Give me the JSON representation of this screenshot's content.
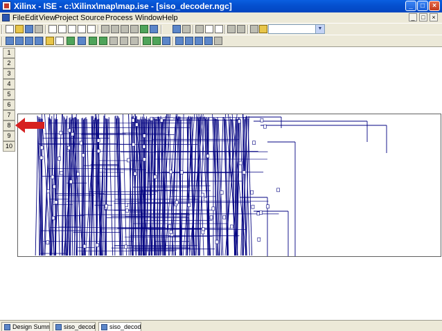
{
  "window": {
    "title": "Xilinx - ISE - c:\\Xilinx\\map\\map.ise - [siso_decoder.ngc]",
    "controls": [
      "_",
      "□",
      "×"
    ],
    "mdi_controls": [
      "_",
      "□",
      "×"
    ]
  },
  "menu": [
    "File",
    "Edit",
    "View",
    "Project",
    "Source",
    "Process",
    "Window",
    "Help"
  ],
  "search_combo": {
    "value": ""
  },
  "row_numbers": [
    "1",
    "2",
    "3",
    "4",
    "5",
    "6",
    "7",
    "8",
    "9",
    "10"
  ],
  "tabs": [
    {
      "label": "Design Summary",
      "active": false
    },
    {
      "label": "siso_decoder",
      "active": false
    },
    {
      "label": "siso_decoder",
      "active": true
    }
  ],
  "colors": {
    "wire": "#000080",
    "annotation_arrow": "#D62020",
    "titlebar": "#0A5FE0"
  },
  "icons": {
    "toolbar1": [
      "new-file-icon",
      "open-folder-icon",
      "save-icon",
      "print-icon",
      "print-preview-icon",
      "document-icon",
      "document-icon",
      "document-icon",
      "document-icon",
      "document-icon",
      "gear-icon",
      "wrench-icon",
      "wrench-icon",
      "wrench-icon",
      "wrench-icon",
      "chart-icon",
      "tool-icon",
      "question-cursor-icon",
      "cut-icon",
      "copy-icon",
      "paste-icon",
      "undo-icon",
      "redo-icon",
      "binoculars-icon",
      "find-icon"
    ],
    "toolbar2": [
      "cascade-icon",
      "tile-icon",
      "layout-icon",
      "layout-icon",
      "lightbulb-icon",
      "pointer-icon",
      "schematic-icon",
      "grid-icon",
      "tree-icon",
      "tree-icon",
      "box-icon",
      "box-icon",
      "chip-icon",
      "chip-icon",
      "globe-icon",
      "zoom-in-icon",
      "zoom-out-icon",
      "zoom-fit-icon",
      "zoom-full-icon",
      "pan-icon"
    ]
  }
}
